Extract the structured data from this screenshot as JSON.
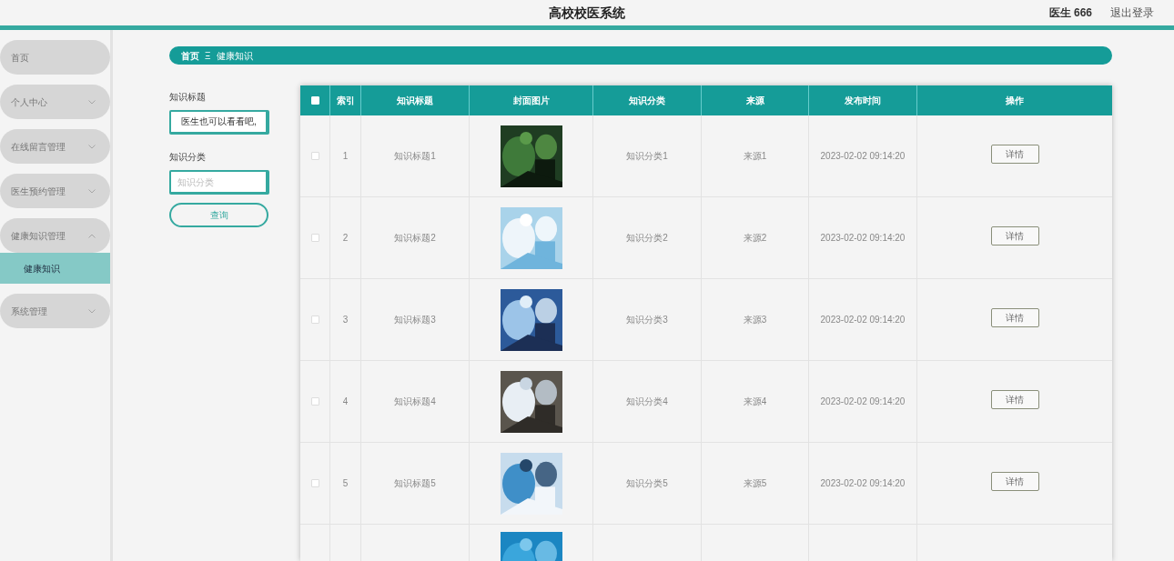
{
  "header": {
    "title": "高校校医系统",
    "user": "医生 666",
    "logout": "退出登录"
  },
  "sidebar": {
    "items": [
      {
        "kind": "link",
        "label": "首页"
      },
      {
        "kind": "group",
        "label": "个人中心",
        "expanded": false
      },
      {
        "kind": "group",
        "label": "在线留言管理",
        "expanded": false
      },
      {
        "kind": "group",
        "label": "医生预约管理",
        "expanded": false
      },
      {
        "kind": "group",
        "label": "健康知识管理",
        "expanded": true,
        "children": [
          {
            "label": "健康知识",
            "selected": true
          }
        ]
      },
      {
        "kind": "group",
        "label": "系统管理",
        "expanded": false
      }
    ]
  },
  "breadcrumb": {
    "home": "首页",
    "separator": "Ξ",
    "current": "健康知识"
  },
  "search": {
    "title_label": "知识标题",
    "title_value": "医生也可以看看吧,",
    "category_label": "知识分类",
    "category_placeholder": "知识分类",
    "button": "查询"
  },
  "table": {
    "select_all_checked": false,
    "columns": [
      "索引",
      "知识标题",
      "封面图片",
      "知识分类",
      "来源",
      "发布时间",
      "操作"
    ],
    "rows": [
      {
        "checked": false,
        "index": "1",
        "title": "知识标题1",
        "category": "知识分类1",
        "source": "来源1",
        "time": "2023-02-02 09:14:20",
        "action": "详情"
      },
      {
        "checked": false,
        "index": "2",
        "title": "知识标题2",
        "category": "知识分类2",
        "source": "来源2",
        "time": "2023-02-02 09:14:20",
        "action": "详情"
      },
      {
        "checked": false,
        "index": "3",
        "title": "知识标题3",
        "category": "知识分类3",
        "source": "来源3",
        "time": "2023-02-02 09:14:20",
        "action": "详情"
      },
      {
        "checked": false,
        "index": "4",
        "title": "知识标题4",
        "category": "知识分类4",
        "source": "来源4",
        "time": "2023-02-02 09:14:20",
        "action": "详情"
      },
      {
        "checked": false,
        "index": "5",
        "title": "知识标题5",
        "category": "知识分类5",
        "source": "来源5",
        "time": "2023-02-02 09:14:20",
        "action": "详情"
      },
      {
        "kind": "partial"
      }
    ]
  }
}
